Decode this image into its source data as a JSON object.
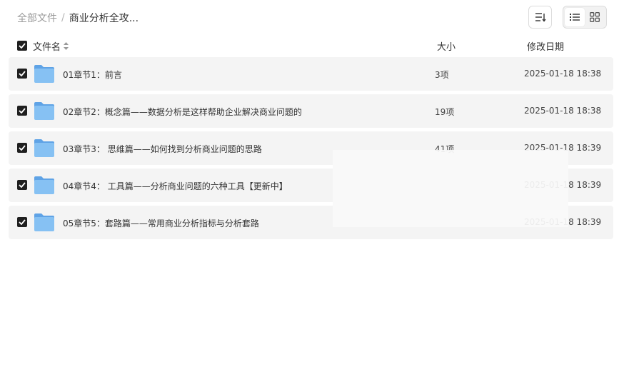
{
  "breadcrumb": {
    "root": "全部文件",
    "separator": "/",
    "current": "商业分析全攻..."
  },
  "header": {
    "name": "文件名",
    "size": "大小",
    "date": "修改日期"
  },
  "files": [
    {
      "name": "01章节1：前言",
      "size": "3项",
      "date": "2025-01-18 18:38"
    },
    {
      "name": "02章节2：概念篇——数据分析是这样帮助企业解决商业问题的",
      "size": "19项",
      "date": "2025-01-18 18:38"
    },
    {
      "name": "03章节3： 思维篇——如何找到分析商业问题的思路",
      "size": "41项",
      "date": "2025-01-18 18:39"
    },
    {
      "name": "04章节4： 工具篇——分析商业问题的六种工具【更新中】",
      "size": "",
      "date": "2025-01-18 18:39"
    },
    {
      "name": "05章节5：套路篇——常用商业分析指标与分析套路",
      "size": "",
      "date": "2025-01-18 18:39"
    }
  ],
  "colors": {
    "folder": "#7db8ee",
    "checkbox": "#1f1f1f",
    "row_bg": "#f4f4f4"
  }
}
